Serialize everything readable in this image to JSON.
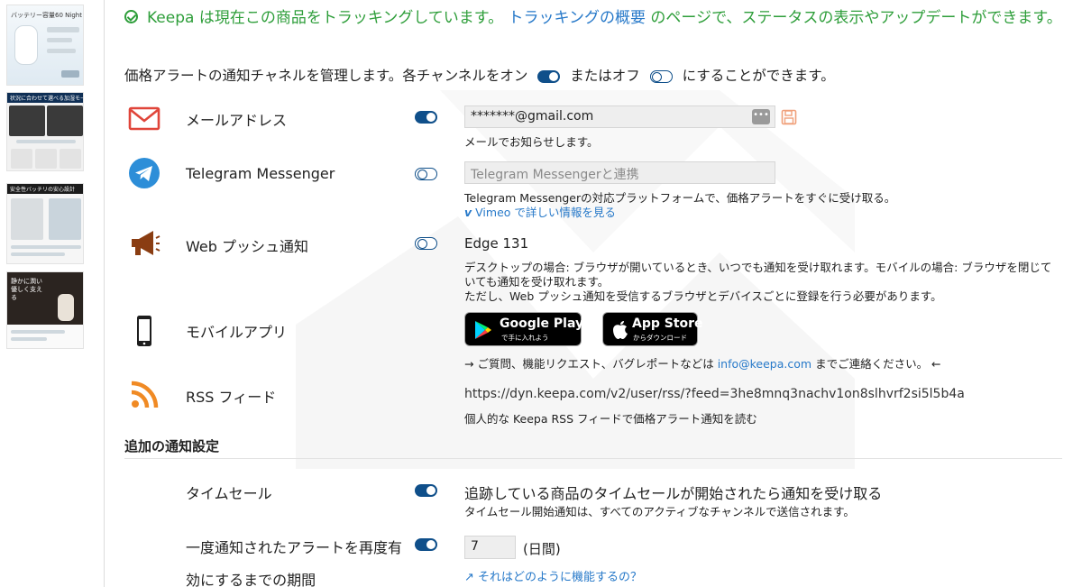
{
  "banner": {
    "prefix": "Keepa は現在この商品をトラッキングしています。",
    "link": "トラッキングの概要",
    "suffix": " のページで、ステータスの表示やアップデートができます。"
  },
  "intro": {
    "part1": "価格アラートの通知チャネルを管理します。各チャンネルをオン",
    "part2": "またはオフ",
    "part3": "にすることができます。"
  },
  "channels": {
    "email": {
      "label": "メールアドレス",
      "enabled": true,
      "value": "*******@gmail.com",
      "note": "メールでお知らせします。"
    },
    "telegram": {
      "label": "Telegram Messenger",
      "enabled": false,
      "placeholder": "Telegram Messengerと連携",
      "note": "Telegram Messengerの対応プラットフォームで、価格アラートをすぐに受け取る。",
      "vimeo_link": "Vimeo で詳しい情報を見る"
    },
    "webpush": {
      "label": "Web プッシュ通知",
      "enabled": false,
      "browser": "Edge 131",
      "note1": "デスクトップの場合: ブラウザが開いているとき、いつでも通知を受け取れます。モバイルの場合: ブラウザを閉じて",
      "note2": "いても通知を受け取れます。",
      "note3": "ただし、Web プッシュ通知を受信するブラウザとデバイスごとに登録を行う必要があります。"
    },
    "mobile": {
      "label": "モバイルアプリ",
      "google_play_big": "Google Play",
      "google_play_small": "で手に入れよう",
      "app_store_big": "App Store",
      "app_store_small": "からダウンロード",
      "contact_prefix": "→ ご質問、機能リクエスト、バグレポートなどは",
      "contact_email": "info@keepa.com",
      "contact_suffix": "までご連絡ください。 ←"
    },
    "rss": {
      "label": "RSS フィード",
      "url": "https://dyn.keepa.com/v2/user/rss/?feed=3he8mnq3nachv1on8slhvrf2si5l5b4a",
      "note": "個人的な Keepa RSS フィードで価格アラート通知を読む"
    }
  },
  "additional": {
    "title": "追加の通知設定",
    "timesale": {
      "label": "タイムセール",
      "enabled": true,
      "desc": "追跡している商品のタイムセールが開始されたら通知を受け取る",
      "note": "タイムセール開始通知は、すべてのアクティブなチャンネルで送信されます。"
    },
    "reenable": {
      "label_line1": "一度通知されたアラートを再度有",
      "label_line2": "効にするまでの期間",
      "enabled": true,
      "value": "7",
      "unit": "(日間)",
      "help_link": "それはどのように機能するの？"
    }
  },
  "thumbnails": {
    "t1_top": "バッテリー容量60 Night",
    "t2_bar": "状況に合わせて選べる加湿モード",
    "t3_bar": "安全性バッチリの安心設計",
    "t4_top": "静かに潤い優しく支える"
  },
  "colors": {
    "success_green": "#2e9e3a",
    "link_blue": "#2779c9",
    "toggle_navy": "#0f4f8a",
    "email_red": "#e0453a",
    "telegram_blue": "#2d8ed8",
    "webpush_brown": "#8a3d12",
    "rss_orange": "#f08a24"
  }
}
